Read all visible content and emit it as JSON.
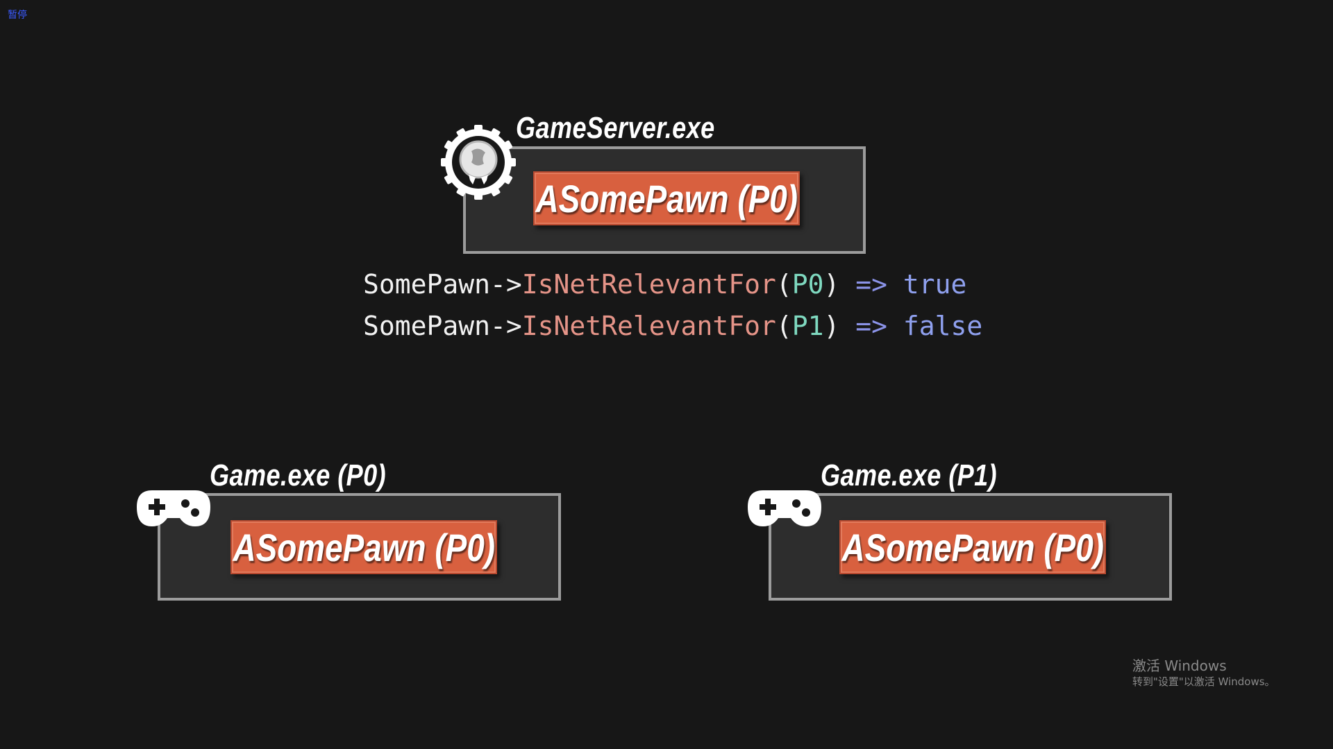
{
  "status": {
    "pause_label": "暂停"
  },
  "server": {
    "title": "GameServer.exe",
    "pawn_label": "ASomePawn (P0)",
    "icon": "server-gear-icon"
  },
  "code_lines": [
    {
      "obj": "SomePawn->",
      "fn": "IsNetRelevantFor",
      "open": "(",
      "arg": "P0",
      "close": ")",
      "op": " => ",
      "result": "true"
    },
    {
      "obj": "SomePawn->",
      "fn": "IsNetRelevantFor",
      "open": "(",
      "arg": "P1",
      "close": ")",
      "op": " => ",
      "result": "false"
    }
  ],
  "clients": [
    {
      "title": "Game.exe (P0)",
      "pawn_label": "ASomePawn (P0)",
      "icon": "gamepad-icon"
    },
    {
      "title": "Game.exe (P1)",
      "pawn_label": "ASomePawn (P0)",
      "icon": "gamepad-icon"
    }
  ],
  "watermark": {
    "line1": "激活 Windows",
    "line2": "转到\"设置\"以激活 Windows。"
  },
  "colors": {
    "background": "#171717",
    "box": "#2d2d2d",
    "box_border": "#9c9c9c",
    "pawn": "#d8603f",
    "code_fn": "#e59488",
    "code_arg": "#7fd9c0",
    "code_kw": "#8fa0ee"
  }
}
